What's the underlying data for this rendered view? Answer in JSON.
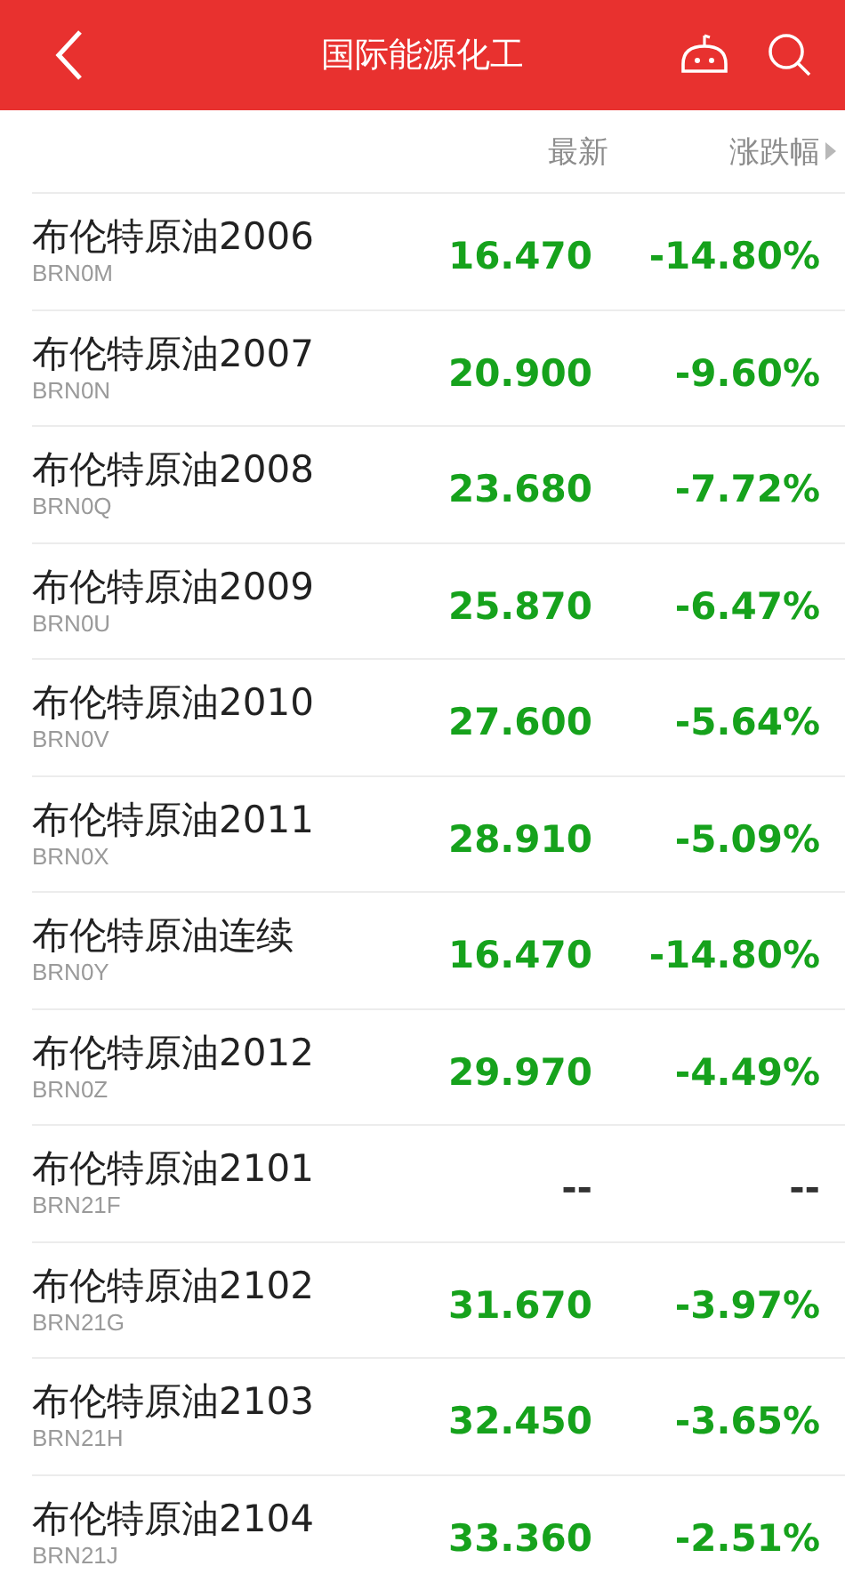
{
  "header": {
    "title": "国际能源化工"
  },
  "columns": [
    {
      "label": "最新",
      "sortable": false
    },
    {
      "label": "涨跌幅",
      "sortable": true
    }
  ],
  "rows": [
    {
      "name": "布伦特原油2006",
      "code": "BRN0M",
      "price": "16.470",
      "change": "-14.80%",
      "kind": "down"
    },
    {
      "name": "布伦特原油2007",
      "code": "BRN0N",
      "price": "20.900",
      "change": "-9.60%",
      "kind": "down"
    },
    {
      "name": "布伦特原油2008",
      "code": "BRN0Q",
      "price": "23.680",
      "change": "-7.72%",
      "kind": "down"
    },
    {
      "name": "布伦特原油2009",
      "code": "BRN0U",
      "price": "25.870",
      "change": "-6.47%",
      "kind": "down"
    },
    {
      "name": "布伦特原油2010",
      "code": "BRN0V",
      "price": "27.600",
      "change": "-5.64%",
      "kind": "down"
    },
    {
      "name": "布伦特原油2011",
      "code": "BRN0X",
      "price": "28.910",
      "change": "-5.09%",
      "kind": "down"
    },
    {
      "name": "布伦特原油连续",
      "code": "BRN0Y",
      "price": "16.470",
      "change": "-14.80%",
      "kind": "down"
    },
    {
      "name": "布伦特原油2012",
      "code": "BRN0Z",
      "price": "29.970",
      "change": "-4.49%",
      "kind": "down"
    },
    {
      "name": "布伦特原油2101",
      "code": "BRN21F",
      "price": "--",
      "change": "--",
      "kind": "flat"
    },
    {
      "name": "布伦特原油2102",
      "code": "BRN21G",
      "price": "31.670",
      "change": "-3.97%",
      "kind": "down"
    },
    {
      "name": "布伦特原油2103",
      "code": "BRN21H",
      "price": "32.450",
      "change": "-3.65%",
      "kind": "down"
    },
    {
      "name": "布伦特原油2104",
      "code": "BRN21J",
      "price": "33.360",
      "change": "-2.51%",
      "kind": "down"
    }
  ]
}
